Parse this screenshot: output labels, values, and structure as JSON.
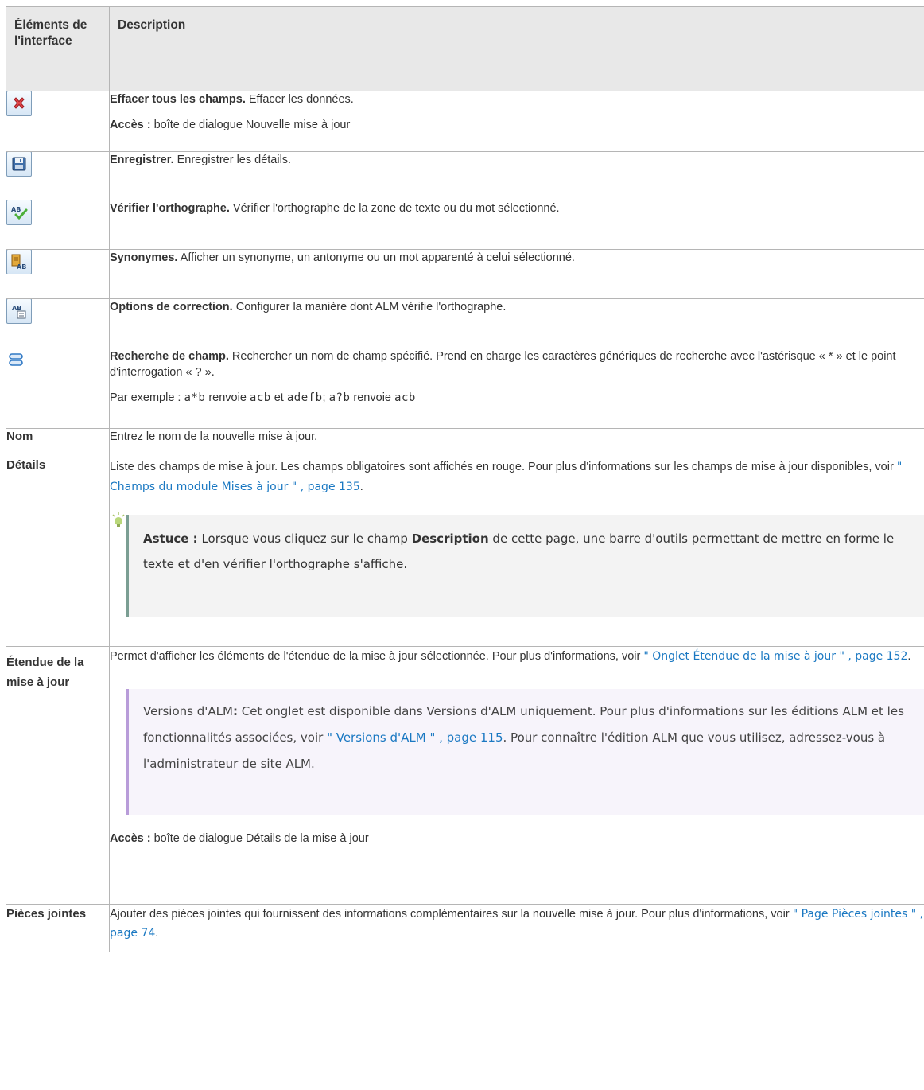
{
  "header": {
    "col1": "Éléments de l'interface",
    "col2": "Description"
  },
  "rows": {
    "clear": {
      "icon": "red-x-icon",
      "title": "Effacer tous les champs.",
      "text": " Effacer les données.",
      "access_label": "Accès :",
      "access_text": " boîte de dialogue Nouvelle mise à jour"
    },
    "save": {
      "icon": "floppy-disk-icon",
      "title": "Enregistrer.",
      "text": " Enregistrer les détails."
    },
    "spell": {
      "icon": "spell-check-icon",
      "title": "Vérifier l'orthographe.",
      "text": " Vérifier l'orthographe de la zone de texte ou du mot sélectionné."
    },
    "synonyms": {
      "icon": "thesaurus-icon",
      "title": "Synonymes.",
      "text": " Afficher un synonyme, un antonyme ou un mot apparenté à celui sélectionné."
    },
    "options": {
      "icon": "spelling-options-icon",
      "title": "Options de correction.",
      "text": " Configurer la manière dont ALM vérifie l'orthographe."
    },
    "search": {
      "icon": "field-search-icon",
      "title": "Recherche de champ.",
      "text": " Rechercher un nom de champ spécifié. Prend en charge les caractères génériques de recherche avec l'astérisque « * » et le point d'interrogation « ? ».",
      "ex_prefix": "Par exemple : ",
      "ex_c1": "a*b",
      "ex_t1": " renvoie ",
      "ex_c2": "acb",
      "ex_t2": "  et ",
      "ex_c3": "adefb",
      "ex_t3": "; ",
      "ex_c4": "a?b",
      "ex_t4": " renvoie ",
      "ex_c5": "acb"
    },
    "name": {
      "label": "Nom",
      "text": "Entrez le nom de la nouvelle mise à jour."
    },
    "details": {
      "label": "Détails",
      "text": "Liste des champs de mise à jour. Les champs obligatoires sont affichés en rouge. Pour plus d'informations sur les champs de mise à jour disponibles, voir ",
      "link": "\" Champs du module Mises à jour \" , page 135",
      "after": ".",
      "tip_label": "Astuce :",
      "tip_a": " Lorsque vous cliquez sur le champ ",
      "tip_b": "Description",
      "tip_c": " de cette page, une barre d'outils permettant de mettre en forme le texte et d'en vérifier l'orthographe s'affiche."
    },
    "scope": {
      "label": "Étendue de la mise à jour",
      "text": "Permet d'afficher les éléments de l'étendue de la mise à jour sélectionnée. Pour plus d'informations, voir ",
      "link": "\" Onglet Étendue de la mise à jour \" , page 152",
      "after": ".",
      "note_label": "Versions d'ALM",
      "note_colon": ":",
      "note_a": " Cet onglet est disponible dans Versions d'ALM uniquement. Pour plus d'informations sur les éditions ALM et les fonctionnalités associées, voir ",
      "note_link": "\" Versions d'ALM \" , page 115",
      "note_b": ". Pour connaître l'édition ALM que vous utilisez, adressez-vous à l'administrateur de site ALM.",
      "access_label": "Accès :",
      "access_text": " boîte de dialogue Détails de la mise à jour"
    },
    "attachments": {
      "label": "Pièces jointes",
      "text": "Ajouter des pièces jointes qui fournissent des informations complémentaires sur la nouvelle mise à jour. Pour plus d'informations, voir ",
      "link": "\" Page Pièces jointes \" , page 74",
      "after": "."
    }
  }
}
